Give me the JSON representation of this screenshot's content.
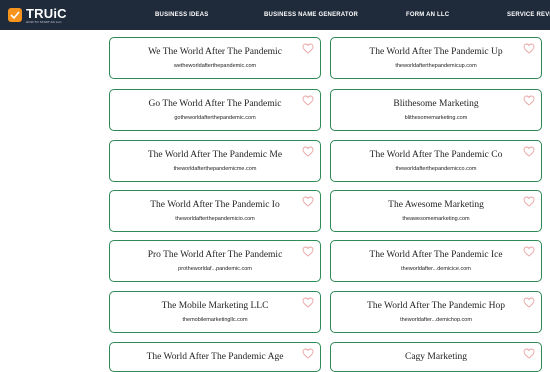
{
  "brand": {
    "logo_text": "TRUiC",
    "tagline": "HOW TO START AN LLC"
  },
  "nav": {
    "items": [
      "BUSINESS IDEAS",
      "BUSINESS NAME GENERATOR",
      "FORM AN LLC",
      "SERVICE REVIEWS"
    ]
  },
  "colors": {
    "topbar": "#1f2a3a",
    "card_border": "#2e8b57",
    "heart": "#e8a3a3",
    "logo": "#f6941d"
  },
  "results": [
    {
      "name": "We The World After The Pandemic",
      "domain": "wetheworldafterthepandemic.com"
    },
    {
      "name": "The World After The Pandemic Up",
      "domain": "theworldafterthepandemicup.com"
    },
    {
      "name": "Go The World After The Pandemic",
      "domain": "gotheworldafterthepandemic.com"
    },
    {
      "name": "Blithesome Marketing",
      "domain": "blithesomemarketing.com"
    },
    {
      "name": "The World After The Pandemic Me",
      "domain": "theworldafterthepandemicme.com"
    },
    {
      "name": "The World After The Pandemic Co",
      "domain": "theworldafterthepandemicco.com"
    },
    {
      "name": "The World After The Pandemic Io",
      "domain": "theworldafterthepandemicio.com"
    },
    {
      "name": "The Awesome Marketing",
      "domain": "theawesomemarketing.com"
    },
    {
      "name": "Pro The World After The Pandemic",
      "domain": "protheworldaf...pandemic.com"
    },
    {
      "name": "The World After The Pandemic Ice",
      "domain": "theworldafter...demicice.com"
    },
    {
      "name": "The Mobile Marketing LLC",
      "domain": "themobilemarketingllc.com"
    },
    {
      "name": "The World After The Pandemic Hop",
      "domain": "theworldafter...demichop.com"
    },
    {
      "name": "The World After The Pandemic Age",
      "domain": ""
    },
    {
      "name": "Cagy Marketing",
      "domain": ""
    }
  ]
}
